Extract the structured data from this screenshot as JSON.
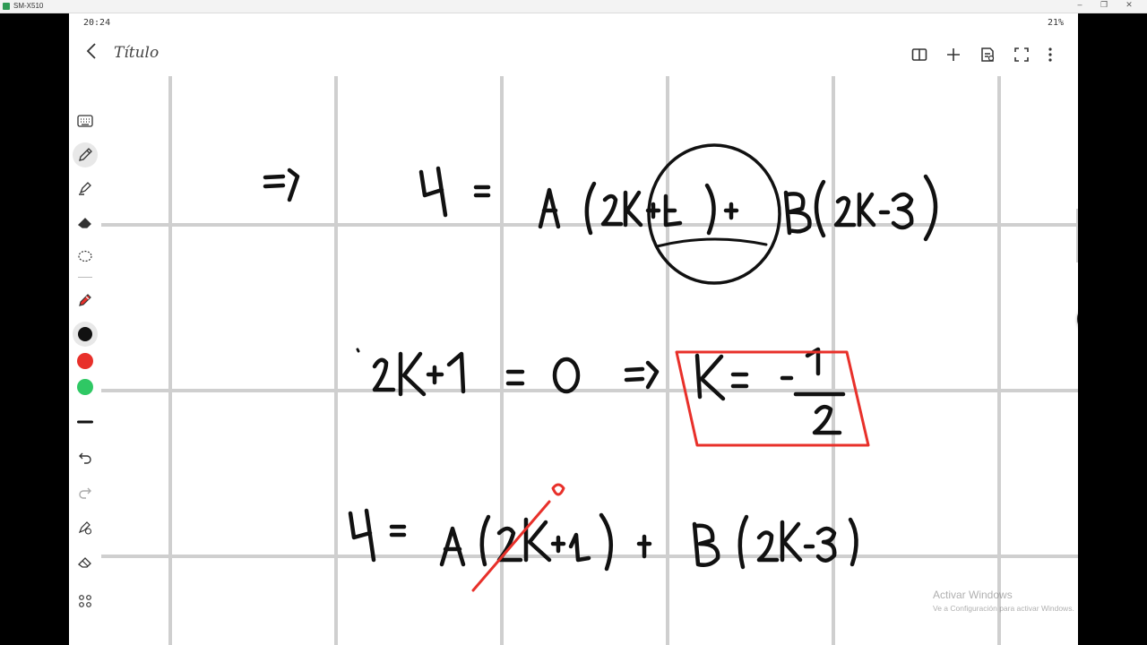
{
  "window": {
    "title": "SM-X510",
    "controls": {
      "minimize": "–",
      "restore": "❐",
      "close": "✕"
    }
  },
  "status_bar": {
    "time": "20:24",
    "battery": "21%"
  },
  "header": {
    "title": "Título",
    "buttons": [
      {
        "name": "book-view-icon"
      },
      {
        "name": "add-icon"
      },
      {
        "name": "edit-doc-icon"
      },
      {
        "name": "fullscreen-icon"
      },
      {
        "name": "more-options-icon"
      }
    ]
  },
  "toolbar": {
    "tools": [
      {
        "name": "keyboard-icon"
      },
      {
        "name": "pen-icon",
        "active": true
      },
      {
        "name": "highlighter-icon"
      },
      {
        "name": "eraser-icon"
      },
      {
        "name": "lasso-icon"
      },
      {
        "name": "red-marker-icon"
      }
    ],
    "colors": [
      "#111111",
      "#e8302a",
      "#2fc864"
    ],
    "actions": [
      {
        "name": "undo-icon"
      },
      {
        "name": "redo-icon"
      },
      {
        "name": "touch-pen-icon"
      },
      {
        "name": "eraser-tool-icon"
      },
      {
        "name": "grid-menu-icon"
      }
    ]
  },
  "colors": {
    "ink": "#111111",
    "accent_red": "#e8302a",
    "grid": "#cfcfcf"
  },
  "watermark": {
    "title": "Activar Windows",
    "subtitle": "Ve a Configuración para activar Windows."
  }
}
